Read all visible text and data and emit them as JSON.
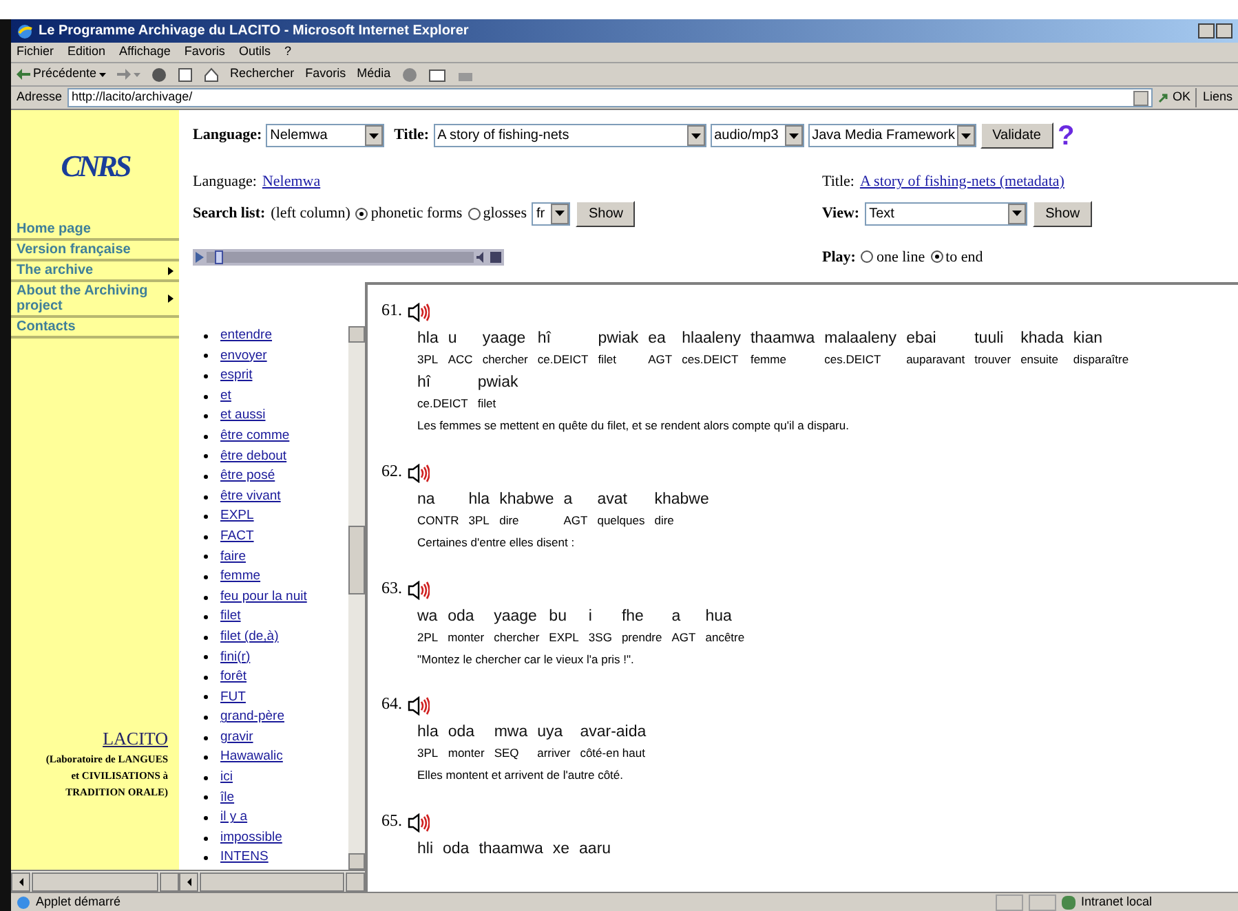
{
  "window": {
    "title": "Le Programme Archivage du LACITO - Microsoft Internet Explorer"
  },
  "menu": [
    "Fichier",
    "Edition",
    "Affichage",
    "Favoris",
    "Outils",
    "?"
  ],
  "toolbar": {
    "back": "Précédente",
    "search": "Rechercher",
    "favorites": "Favoris",
    "media": "Média"
  },
  "address": {
    "label": "Adresse",
    "url": "http://lacito/archivage/",
    "go": "OK",
    "links": "Liens"
  },
  "sidebar": {
    "logo": "CNRS",
    "items": [
      {
        "label": "Home page",
        "submenu": false
      },
      {
        "label": "Version française",
        "submenu": false
      },
      {
        "label": "The archive",
        "submenu": true
      },
      {
        "label": "About the Archiving project",
        "submenu": true
      },
      {
        "label": "Contacts",
        "submenu": false
      }
    ],
    "footer_link": "LACITO",
    "footer_lines": [
      "(Laboratoire de LANGUES",
      "et CIVILISATIONS à",
      "TRADITION ORALE)"
    ]
  },
  "form": {
    "language_label": "Language:",
    "language": "Nelemwa",
    "title_label": "Title:",
    "title": "A story of fishing-nets",
    "format": "audio/mp3",
    "player": "Java Media Framework",
    "validate": "Validate",
    "help": "?"
  },
  "info": {
    "language_label": "Language:",
    "language_link": "Nelemwa",
    "title_label": "Title:",
    "title_link": "A story of fishing-nets (metadata)",
    "search_label": "Search list:",
    "search_note": "(left column)",
    "search_options": [
      {
        "label": "phonetic forms",
        "selected": true
      },
      {
        "label": "glosses",
        "selected": false
      }
    ],
    "search_lang": "fr",
    "search_show": "Show",
    "view_label": "View:",
    "view": "Text",
    "view_show": "Show",
    "play_label": "Play:",
    "play_options": [
      {
        "label": "one line",
        "selected": false
      },
      {
        "label": "to end",
        "selected": true
      }
    ]
  },
  "player": {
    "level": 0.03
  },
  "word_list": [
    "entendre",
    "envoyer",
    "esprit",
    "et",
    "et aussi",
    "être comme",
    "être debout",
    "être posé",
    "être vivant",
    "EXPL",
    "FACT",
    "faire",
    "femme",
    "feu pour la nuit",
    "filet",
    "filet (de,à)",
    "fini(r)",
    "forêt",
    "FUT",
    "grand-père",
    "gravir",
    "Hawawalic",
    "ici",
    "île",
    "il y a",
    "impossible",
    "INTENS"
  ],
  "sentences": [
    {
      "number": "61.",
      "words": [
        {
          "form": "hla",
          "gloss": "3PL"
        },
        {
          "form": "u",
          "gloss": "ACC"
        },
        {
          "form": "yaage",
          "gloss": "chercher"
        },
        {
          "form": "hî",
          "gloss": "ce.DEICT"
        },
        {
          "form": "pwiak",
          "gloss": "filet"
        },
        {
          "form": "ea",
          "gloss": "AGT"
        },
        {
          "form": "hlaaleny",
          "gloss": "ces.DEICT"
        },
        {
          "form": "thaamwa",
          "gloss": "femme"
        },
        {
          "form": "malaaleny",
          "gloss": "ces.DEICT"
        },
        {
          "form": "ebai",
          "gloss": "auparavant"
        },
        {
          "form": "tuuli",
          "gloss": "trouver"
        },
        {
          "form": "khada",
          "gloss": "ensuite"
        },
        {
          "form": "kian",
          "gloss": "disparaître"
        },
        {
          "form": "hî",
          "gloss": "ce.DEICT"
        },
        {
          "form": "pwiak",
          "gloss": "filet"
        }
      ],
      "translation": "Les femmes se mettent en quête du filet, et se rendent alors compte qu'il a disparu."
    },
    {
      "number": "62.",
      "words": [
        {
          "form": "na",
          "gloss": "CONTR"
        },
        {
          "form": "hla",
          "gloss": "3PL"
        },
        {
          "form": "khabwe",
          "gloss": "dire"
        },
        {
          "form": "a",
          "gloss": "AGT"
        },
        {
          "form": "avat",
          "gloss": "quelques"
        },
        {
          "form": "khabwe",
          "gloss": "dire"
        }
      ],
      "translation": "Certaines d'entre elles disent :"
    },
    {
      "number": "63.",
      "words": [
        {
          "form": "wa",
          "gloss": "2PL"
        },
        {
          "form": "oda",
          "gloss": "monter"
        },
        {
          "form": "yaage",
          "gloss": "chercher"
        },
        {
          "form": "bu",
          "gloss": "EXPL"
        },
        {
          "form": "i",
          "gloss": "3SG"
        },
        {
          "form": "fhe",
          "gloss": "prendre"
        },
        {
          "form": "a",
          "gloss": "AGT"
        },
        {
          "form": "hua",
          "gloss": "ancêtre"
        }
      ],
      "translation": "\"Montez le chercher car le vieux l'a pris !\"."
    },
    {
      "number": "64.",
      "words": [
        {
          "form": "hla",
          "gloss": "3PL"
        },
        {
          "form": "oda",
          "gloss": "monter"
        },
        {
          "form": "mwa",
          "gloss": "SEQ"
        },
        {
          "form": "uya",
          "gloss": "arriver"
        },
        {
          "form": "avar-aida",
          "gloss": "côté-en haut"
        }
      ],
      "translation": "Elles montent et arrivent de l'autre côté."
    },
    {
      "number": "65.",
      "words": [
        {
          "form": "hli"
        },
        {
          "form": "oda"
        },
        {
          "form": "thaamwa"
        },
        {
          "form": "xe"
        },
        {
          "form": "aaru"
        }
      ]
    }
  ],
  "status_bar": {
    "message": "Applet démarré",
    "zone": "Intranet local"
  }
}
